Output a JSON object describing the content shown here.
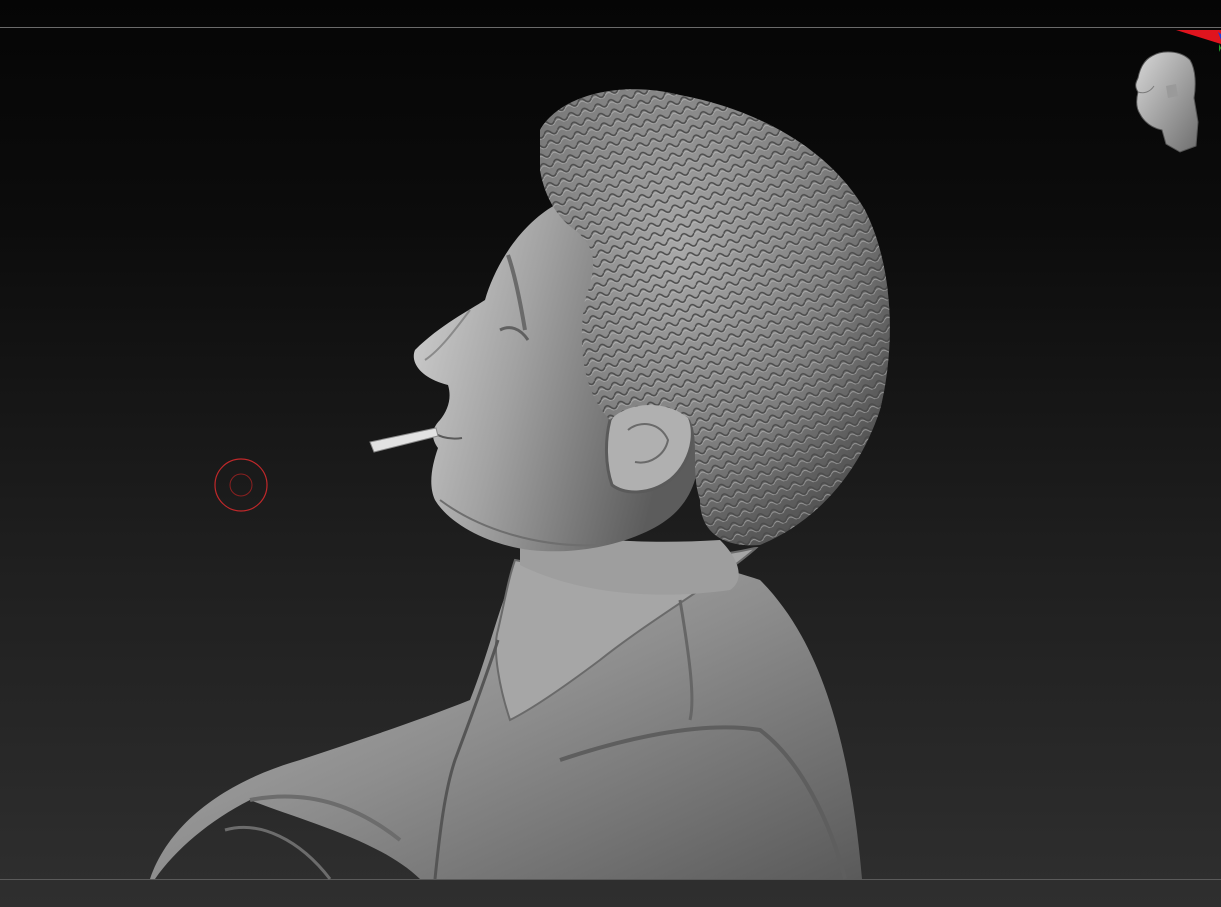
{
  "app": {
    "name": "",
    "view": "3d-viewport"
  },
  "viewport": {
    "background_top": "#050505",
    "background_bottom": "#2f2f2f",
    "frame_line_color": "#6a6a6a"
  },
  "model": {
    "material_color": "#9a9a9a",
    "subject": "sculpted bust"
  },
  "brush_cursor": {
    "color": "#c0282a",
    "icon": "brush-ring-icon"
  },
  "navigation_gizmo": {
    "icon": "orientation-head-icon",
    "axis_colors": {
      "x": "#e0141e",
      "y": "#1fa32a",
      "z": "#1a3cd8"
    }
  }
}
